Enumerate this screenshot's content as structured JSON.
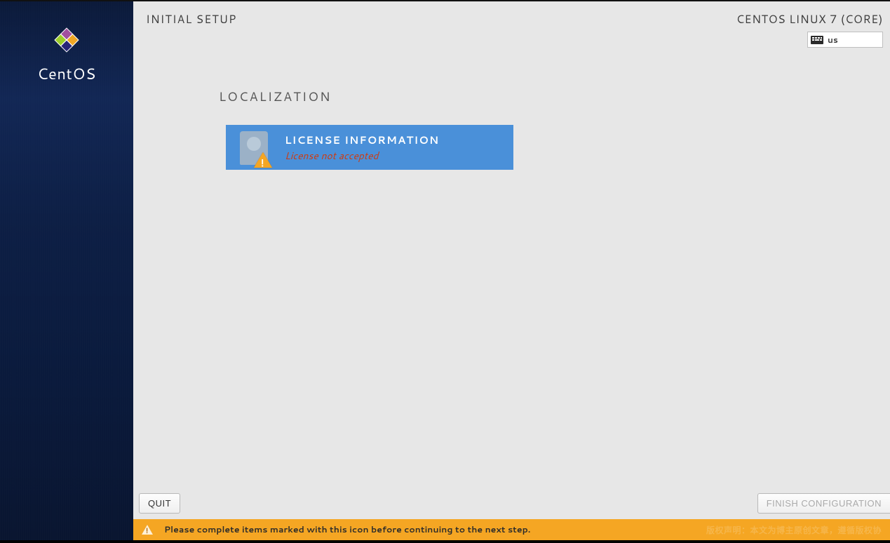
{
  "sidebar": {
    "brand": "CentOS"
  },
  "header": {
    "title": "INITIAL SETUP",
    "distro": "CENTOS LINUX 7 (CORE)",
    "keyboard_layout": "us"
  },
  "content": {
    "section_title": "LOCALIZATION",
    "spokes": [
      {
        "title": "LICENSE INFORMATION",
        "status": "License not accepted",
        "has_warning": true
      }
    ]
  },
  "footer": {
    "quit_label": "QUIT",
    "finish_label": "FINISH CONFIGURATION"
  },
  "infobar": {
    "message": "Please complete items marked with this icon before continuing to the next step.",
    "watermark": "版权声明：本文为博主原创文章，遵循版权协"
  }
}
